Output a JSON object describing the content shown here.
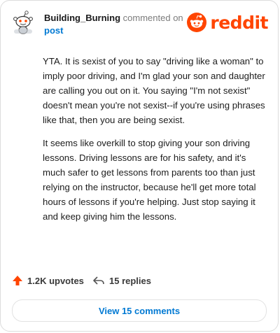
{
  "comment": {
    "author": "Building_Burning",
    "action_text": "commented on",
    "target": "post",
    "paragraphs": [
      "YTA. It is sexist of you to say \"driving like a woman\" to imply poor driving, and I'm glad your son and daughter are calling you out on it. You saying \"I'm not sexist\" doesn't mean you're not sexist--if you're using phrases like that, then you are being sexist.",
      "It seems like overkill to stop giving your son driving lessons. Driving lessons are for his safety, and it's much safer to get lessons from parents too than just relying on the instructor, because he'll get more total hours of lessons if you're helping. Just stop saying it and keep giving him the lessons."
    ],
    "upvotes": "1.2K upvotes",
    "replies": "15 replies",
    "view_comments": "View 15 comments"
  },
  "brand": {
    "logo_text": "reddit",
    "color": "#ff4500",
    "link_color": "#0079d3"
  },
  "icons": {
    "avatar": "snoo-avatar-icon",
    "logo": "reddit-logo-icon",
    "upvote": "upvote-arrow-icon",
    "reply": "reply-arrow-icon"
  }
}
